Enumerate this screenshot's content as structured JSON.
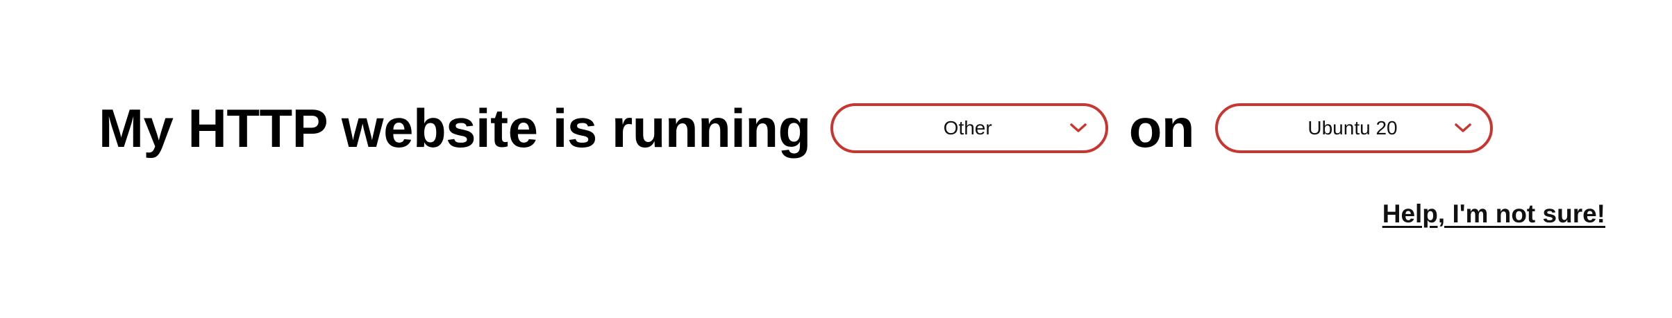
{
  "headline": {
    "prefix": "My HTTP website is running",
    "connector": "on"
  },
  "software_select": {
    "selected": "Other",
    "icon": "chevron-down-icon"
  },
  "os_select": {
    "selected": "Ubuntu 20",
    "icon": "chevron-down-icon"
  },
  "help_link": {
    "label": "Help, I'm not sure!"
  },
  "colors": {
    "accent": "#c9352f",
    "text": "#000000",
    "background": "#ffffff"
  }
}
